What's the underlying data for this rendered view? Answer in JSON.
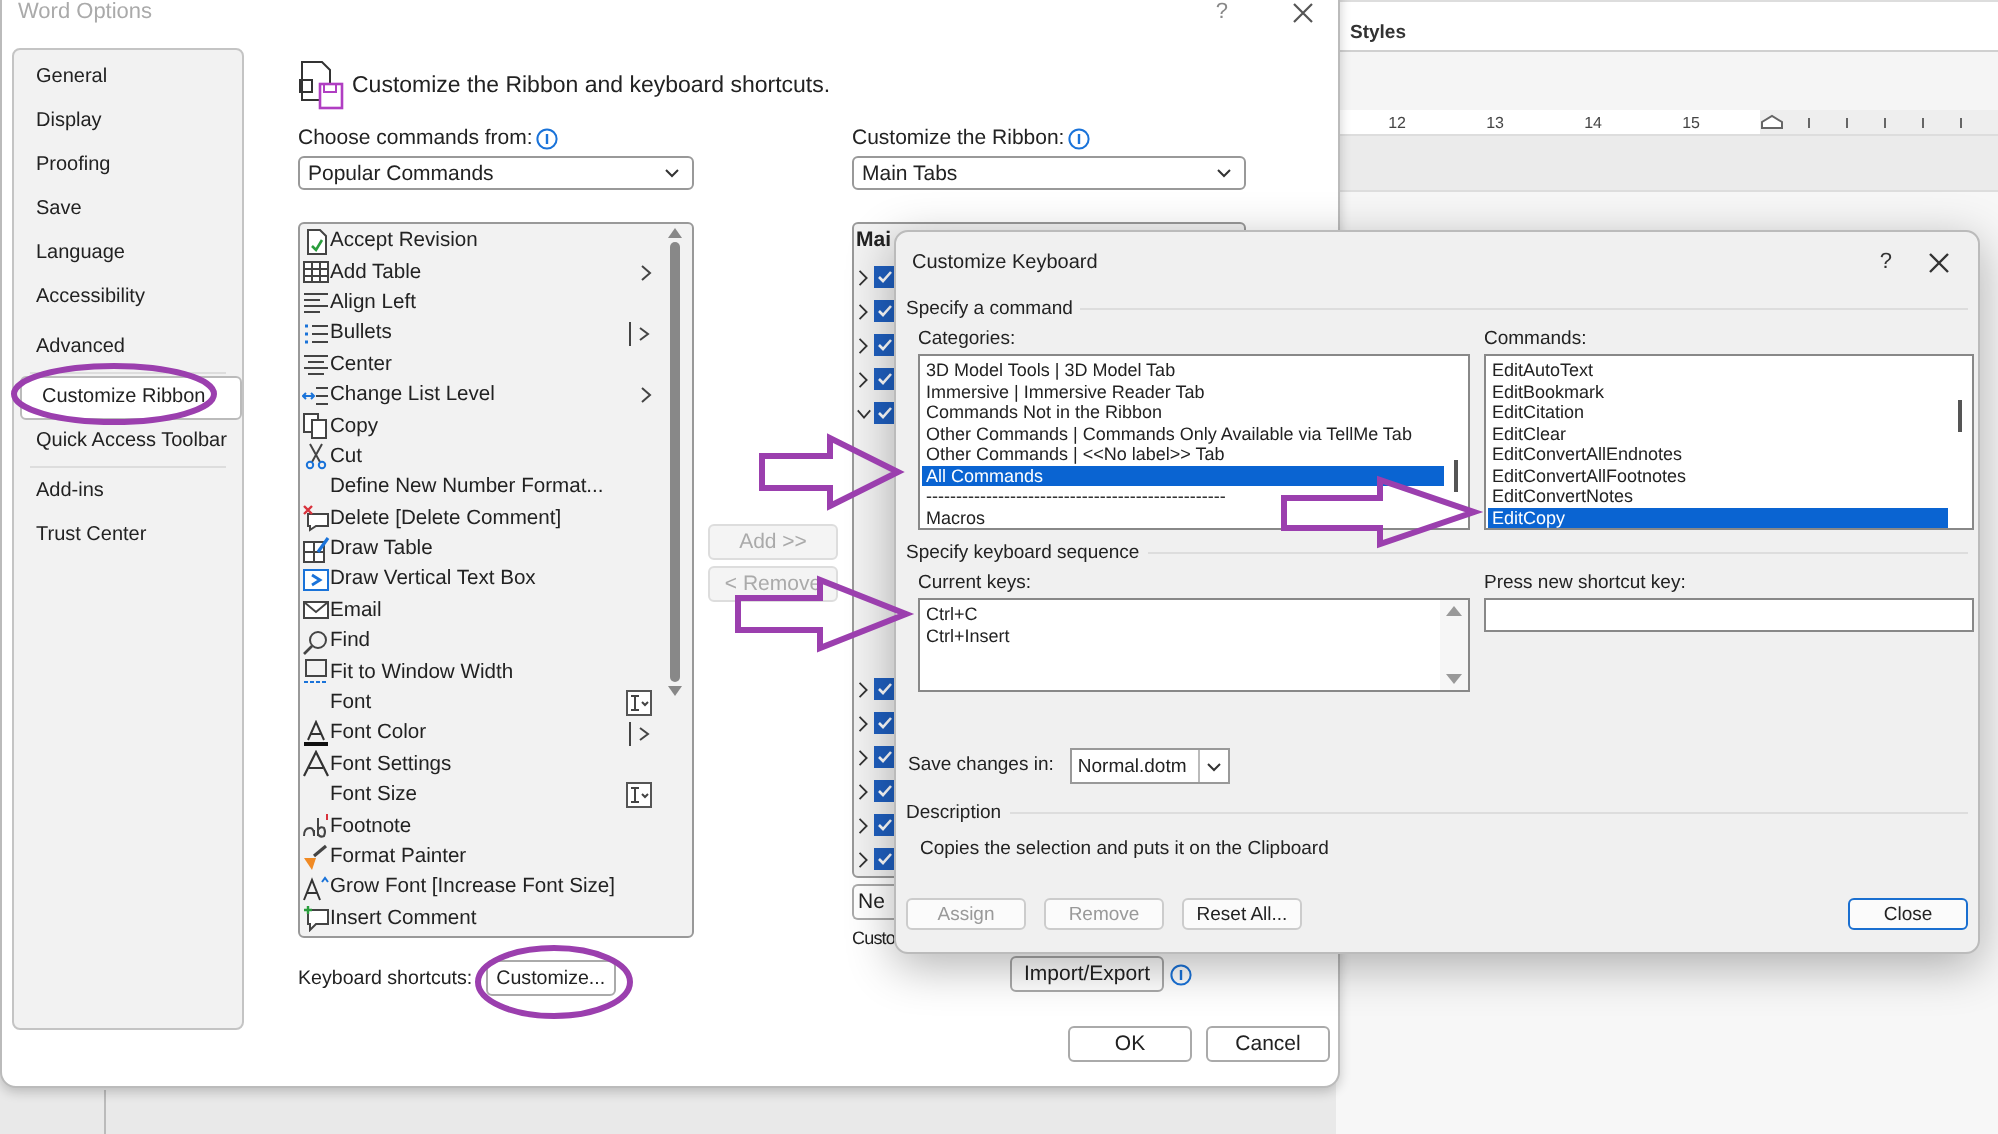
{
  "document": {
    "pane_title": "Styles",
    "ruler_numbers": [
      "12",
      "13",
      "14",
      "15"
    ]
  },
  "options": {
    "title": "Word Options",
    "help": "?",
    "sidebar_groups": [
      [
        {
          "label": "General",
          "selected": false
        },
        {
          "label": "Display",
          "selected": false
        },
        {
          "label": "Proofing",
          "selected": false
        },
        {
          "label": "Save",
          "selected": false
        },
        {
          "label": "Language",
          "selected": false
        },
        {
          "label": "Accessibility",
          "selected": false
        },
        {
          "label": "Advanced",
          "selected": false
        }
      ],
      [
        {
          "label": "Customize Ribbon",
          "selected": true
        },
        {
          "label": "Quick Access Toolbar",
          "selected": false
        }
      ],
      [
        {
          "label": "Add-ins",
          "selected": false
        },
        {
          "label": "Trust Center",
          "selected": false
        }
      ]
    ],
    "heading": "Customize the Ribbon and keyboard shortcuts.",
    "commands_from": {
      "label": "Choose commands from:",
      "value": "Popular Commands"
    },
    "commands": [
      {
        "label": "Accept Revision",
        "kind": "plain"
      },
      {
        "label": "Add Table",
        "kind": "submenu"
      },
      {
        "label": "Align Left",
        "kind": "plain"
      },
      {
        "label": "Bullets",
        "kind": "split"
      },
      {
        "label": "Center",
        "kind": "plain"
      },
      {
        "label": "Change List Level",
        "kind": "submenu"
      },
      {
        "label": "Copy",
        "kind": "plain"
      },
      {
        "label": "Cut",
        "kind": "plain"
      },
      {
        "label": "Define New Number Format...",
        "kind": "plain"
      },
      {
        "label": "Delete [Delete Comment]",
        "kind": "plain"
      },
      {
        "label": "Draw Table",
        "kind": "plain"
      },
      {
        "label": "Draw Vertical Text Box",
        "kind": "plain"
      },
      {
        "label": "Email",
        "kind": "plain"
      },
      {
        "label": "Find",
        "kind": "plain"
      },
      {
        "label": "Fit to Window Width",
        "kind": "plain"
      },
      {
        "label": "Font",
        "kind": "combo"
      },
      {
        "label": "Font Color",
        "kind": "split"
      },
      {
        "label": "Font Settings",
        "kind": "plain"
      },
      {
        "label": "Font Size",
        "kind": "combo"
      },
      {
        "label": "Footnote",
        "kind": "plain"
      },
      {
        "label": "Format Painter",
        "kind": "plain"
      },
      {
        "label": "Grow Font [Increase Font Size]",
        "kind": "plain"
      },
      {
        "label": "Insert Comment",
        "kind": "plain"
      }
    ],
    "move_buttons": [
      {
        "label": "Add >>",
        "disabled": true
      },
      {
        "label": "< Remove",
        "disabled": true
      }
    ],
    "ribbon": {
      "label": "Customize the Ribbon:",
      "value": "Main Tabs",
      "list_header": "Mai",
      "upper_tabs": [
        {
          "expanded": false,
          "checked": true
        },
        {
          "expanded": false,
          "checked": true
        },
        {
          "expanded": false,
          "checked": true
        },
        {
          "expanded": false,
          "checked": true
        },
        {
          "expanded": true,
          "checked": true
        }
      ],
      "lower_tabs": [
        {
          "expanded": false,
          "checked": true
        },
        {
          "expanded": false,
          "checked": true
        },
        {
          "expanded": false,
          "checked": true
        },
        {
          "expanded": false,
          "checked": true
        },
        {
          "expanded": false,
          "checked": true
        },
        {
          "expanded": false,
          "checked": true
        }
      ],
      "new_button": "Ne",
      "customizations_label": "Custo",
      "import_export": "Import/Export"
    },
    "keyboard_label": "Keyboard shortcuts:",
    "customize_button": "Customize...",
    "ok": "OK",
    "cancel": "Cancel"
  },
  "keyboard_dialog": {
    "title": "Customize Keyboard",
    "help": "?",
    "command_section": "Specify a command",
    "categories_label": "Categories:",
    "categories": [
      {
        "label": "3D Model Tools | 3D Model Tab",
        "selected": false
      },
      {
        "label": "Immersive | Immersive Reader Tab",
        "selected": false
      },
      {
        "label": "Commands Not in the Ribbon",
        "selected": false
      },
      {
        "label": "Other Commands | Commands Only Available via TellMe Tab",
        "selected": false
      },
      {
        "label": "Other Commands | <<No label>> Tab",
        "selected": false
      },
      {
        "label": "All Commands",
        "selected": true
      },
      {
        "label": "--------------------------------------------------",
        "selected": false
      },
      {
        "label": "Macros",
        "selected": false
      }
    ],
    "commands_label": "Commands:",
    "commands": [
      {
        "label": "EditAutoText",
        "selected": false
      },
      {
        "label": "EditBookmark",
        "selected": false
      },
      {
        "label": "EditCitation",
        "selected": false
      },
      {
        "label": "EditClear",
        "selected": false
      },
      {
        "label": "EditConvertAllEndnotes",
        "selected": false
      },
      {
        "label": "EditConvertAllFootnotes",
        "selected": false
      },
      {
        "label": "EditConvertNotes",
        "selected": false
      },
      {
        "label": "EditCopy",
        "selected": true
      }
    ],
    "sequence_section": "Specify keyboard sequence",
    "current_keys_label": "Current keys:",
    "current_keys": [
      "Ctrl+C",
      "Ctrl+Insert"
    ],
    "new_key_label": "Press new shortcut key:",
    "save_label": "Save changes in:",
    "save_value": "Normal.dotm",
    "description_section": "Description",
    "description": "Copies the selection and puts it on the Clipboard",
    "buttons": [
      {
        "label": "Assign",
        "disabled": true,
        "default": false
      },
      {
        "label": "Remove",
        "disabled": true,
        "default": false
      },
      {
        "label": "Reset All...",
        "disabled": false,
        "default": false
      }
    ],
    "close_button": {
      "label": "Close",
      "disabled": false,
      "default": true
    }
  }
}
